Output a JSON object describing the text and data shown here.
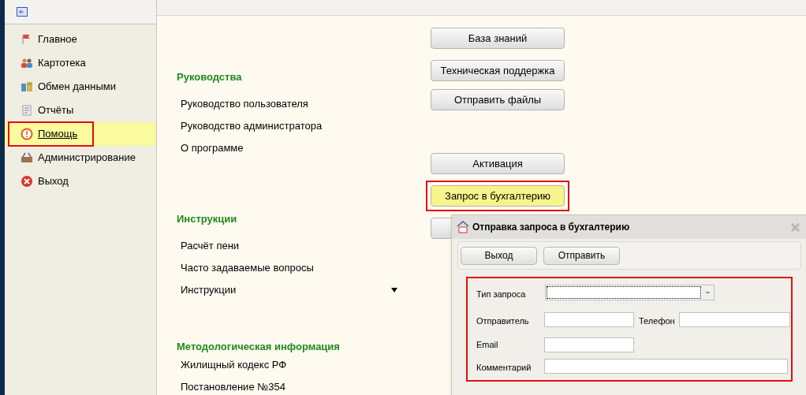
{
  "sidebar": {
    "items": [
      {
        "label": "Главное",
        "kind": "flag",
        "selected": false,
        "highlighted": false
      },
      {
        "label": "Картотека",
        "kind": "people",
        "selected": false,
        "highlighted": false
      },
      {
        "label": "Обмен данными",
        "kind": "exchange",
        "selected": false,
        "highlighted": false
      },
      {
        "label": "Отчёты",
        "kind": "reports",
        "selected": false,
        "highlighted": false
      },
      {
        "label": "Помощь",
        "kind": "help",
        "selected": true,
        "highlighted": true
      },
      {
        "label": "Администрирование",
        "kind": "tools",
        "selected": false,
        "highlighted": false
      },
      {
        "label": "Выход",
        "kind": "exit",
        "selected": false,
        "highlighted": false
      }
    ]
  },
  "sections": [
    {
      "title": "Руководства",
      "links": [
        {
          "label": "Руководство пользователя"
        },
        {
          "label": "Руководство администратора"
        },
        {
          "label": "О программе"
        }
      ]
    },
    {
      "title": "Инструкции",
      "links": [
        {
          "label": "Расчёт пени"
        },
        {
          "label": "Часто задаваемые вопросы"
        },
        {
          "label": "Инструкции",
          "dropdown": true
        }
      ]
    },
    {
      "title": "Методологическая информация",
      "links": [
        {
          "label": "Жилищный кодекс РФ"
        },
        {
          "label": "Постановление №354"
        }
      ]
    }
  ],
  "buttons": [
    {
      "label": "База знаний",
      "selected": false,
      "highlighted": false
    },
    {
      "label": "Техническая поддержка",
      "selected": false,
      "highlighted": false
    },
    {
      "label": "Отправить файлы",
      "selected": false,
      "highlighted": false
    },
    {
      "label": "Активация",
      "selected": false,
      "highlighted": false
    },
    {
      "label": "Запрос в бухгалтерию",
      "selected": true,
      "highlighted": true
    },
    {
      "selected": false,
      "highlighted": false
    }
  ],
  "dialog": {
    "title": "Отправка запроса в бухгалтерию",
    "buttons": [
      "Выход",
      "Отправить"
    ],
    "form_highlighted": true,
    "fields": {
      "request_type": {
        "label": "Тип запроса"
      },
      "sender": {
        "label": "Отправитель"
      },
      "phone": {
        "label": "Телефон"
      },
      "email": {
        "label": "Email"
      },
      "comment": {
        "label": "Комментарий"
      }
    }
  }
}
